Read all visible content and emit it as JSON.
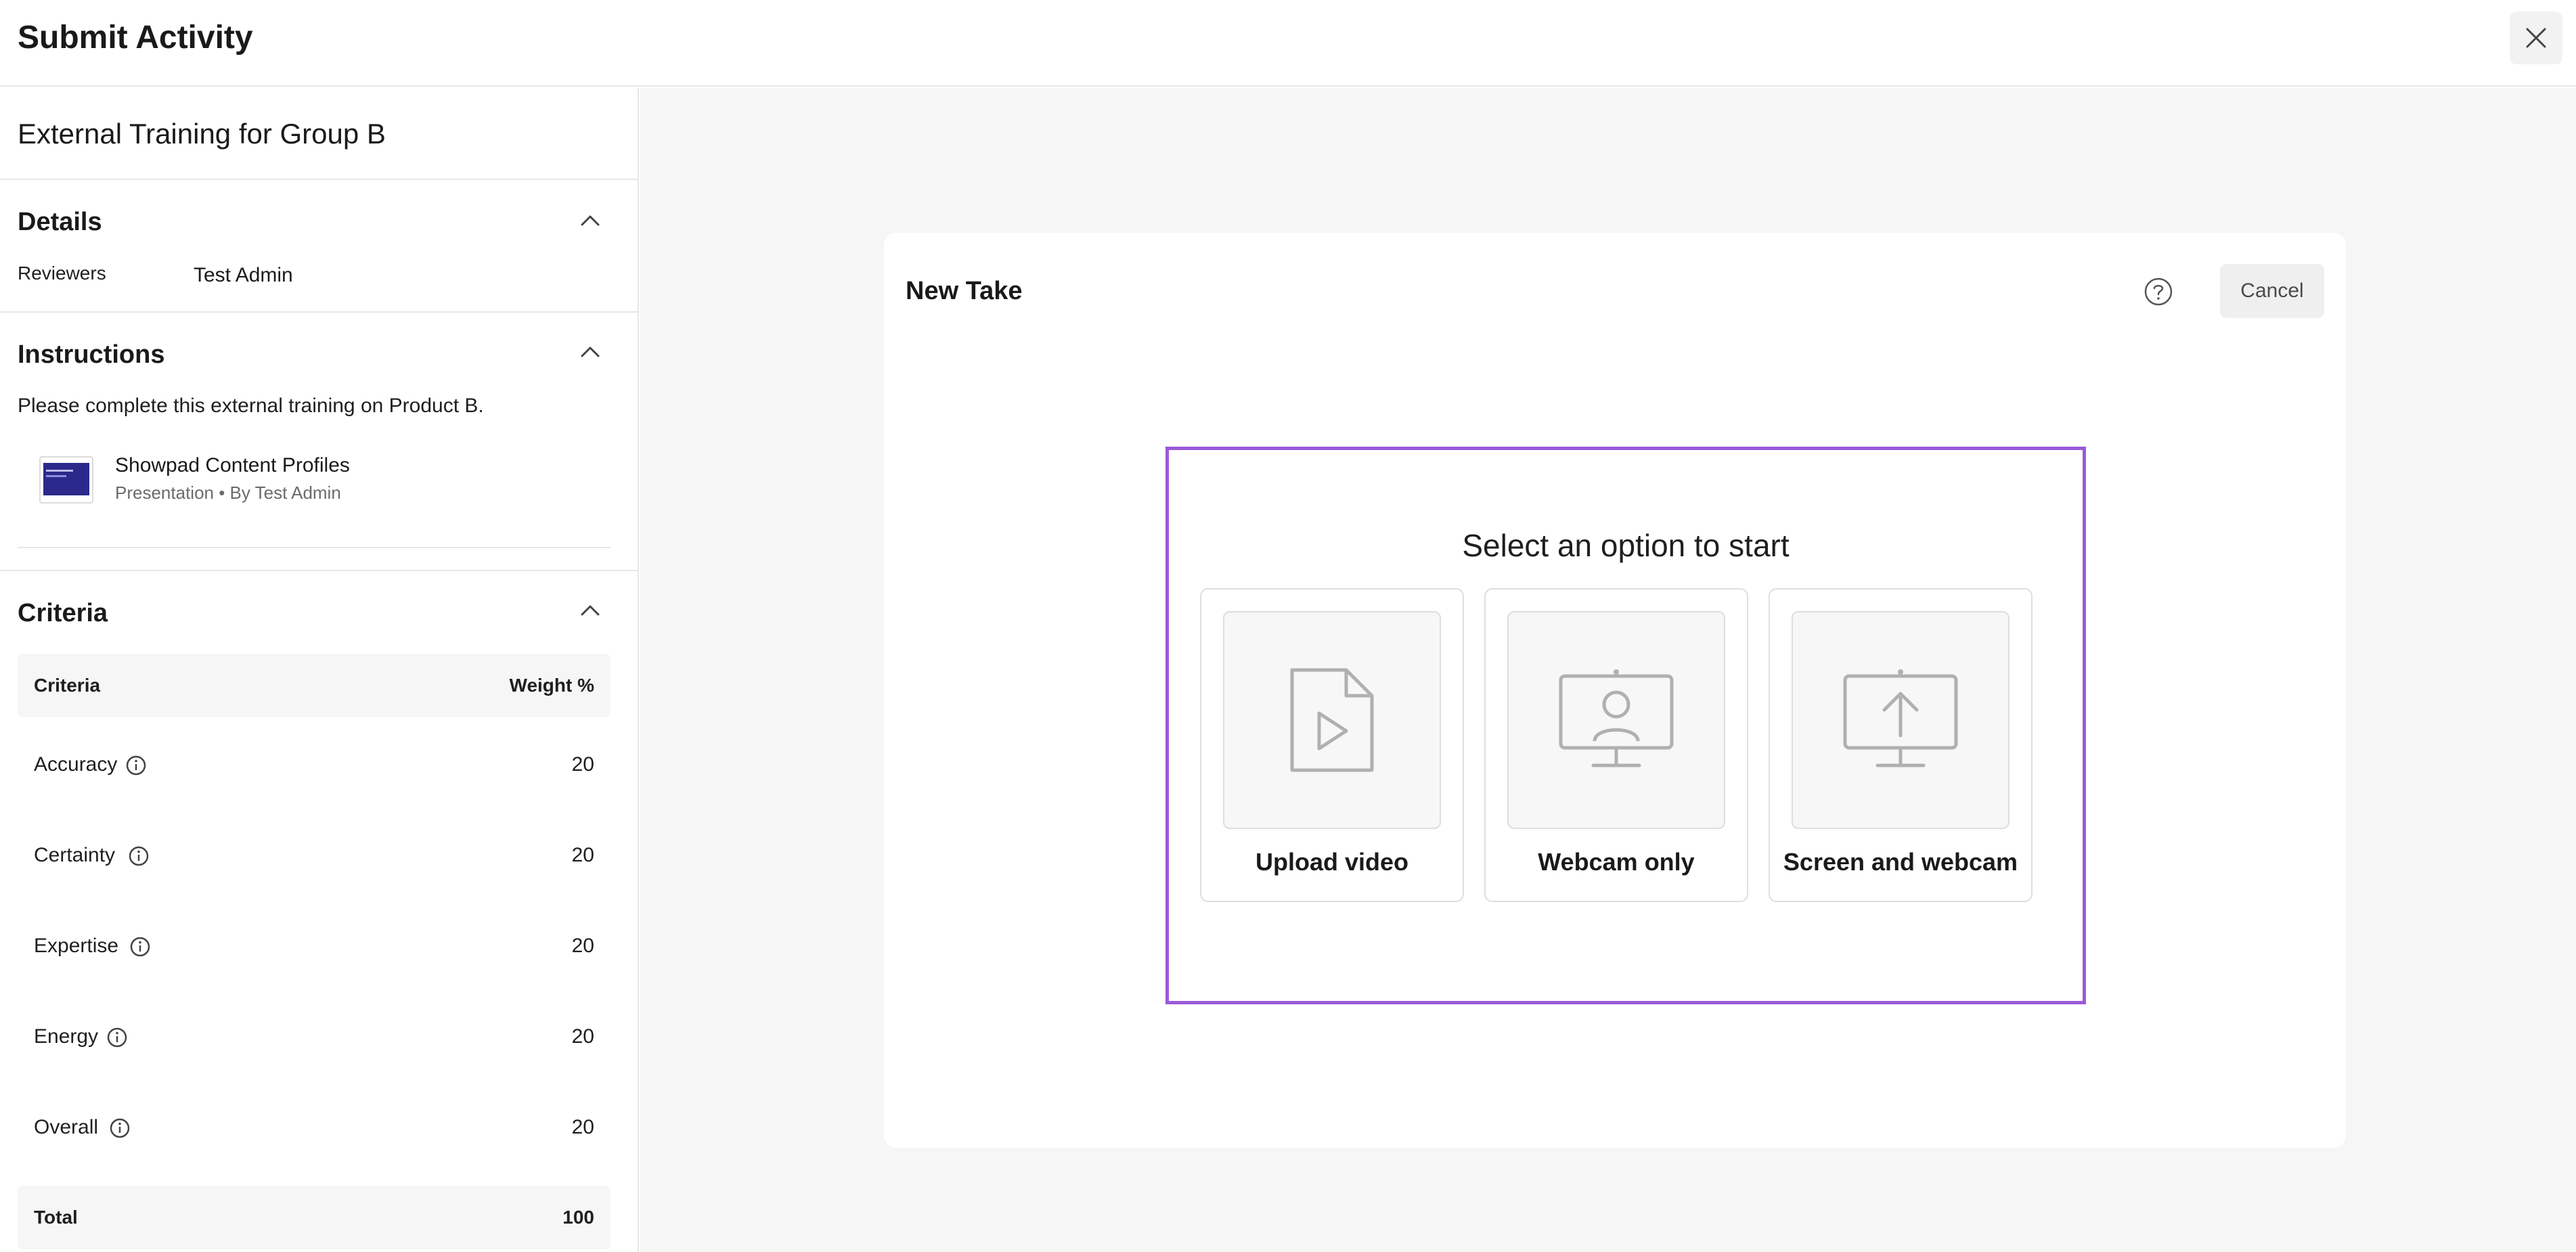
{
  "header": {
    "title": "Submit Activity"
  },
  "sidebar": {
    "activity_name": "External Training for Group B",
    "details": {
      "title": "Details",
      "reviewers_label": "Reviewers",
      "reviewers_value": "Test Admin"
    },
    "instructions": {
      "title": "Instructions",
      "text": "Please complete this external training on Product B.",
      "asset": {
        "name": "Showpad Content Profiles",
        "meta": "Presentation  •  By Test Admin"
      }
    },
    "criteria": {
      "title": "Criteria",
      "col_criteria": "Criteria",
      "col_weight": "Weight %",
      "rows": [
        {
          "name": "Accuracy",
          "weight": "20"
        },
        {
          "name": "Certainty",
          "weight": "20"
        },
        {
          "name": "Expertise",
          "weight": "20"
        },
        {
          "name": "Energy",
          "weight": "20"
        },
        {
          "name": "Overall",
          "weight": "20"
        }
      ],
      "total_label": "Total",
      "total_value": "100"
    }
  },
  "main": {
    "card_title": "New Take",
    "cancel_label": "Cancel",
    "prompt": "Select an option to start",
    "options": [
      {
        "label": "Upload video",
        "icon": "video-file-icon"
      },
      {
        "label": "Webcam only",
        "icon": "webcam-monitor-icon"
      },
      {
        "label": "Screen and webcam",
        "icon": "screen-share-icon"
      }
    ]
  },
  "colors": {
    "accent_outline": "#9b59d9",
    "background_main": "#f6f6f6"
  }
}
